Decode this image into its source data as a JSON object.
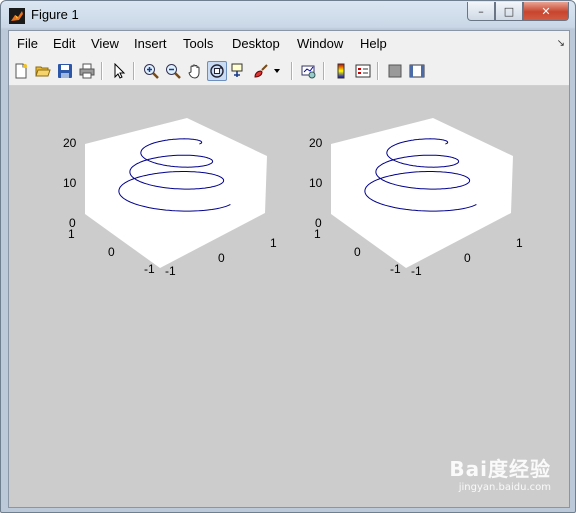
{
  "window": {
    "title": "Figure 1",
    "controls": {
      "minimize": "–",
      "maximize": "□",
      "close": "✕"
    }
  },
  "menubar": {
    "items": [
      "File",
      "Edit",
      "View",
      "Insert",
      "Tools",
      "Desktop",
      "Window",
      "Help"
    ],
    "dock_arrow": "↘"
  },
  "toolbar": {
    "tools": [
      "new-figure-icon",
      "open-file-icon",
      "save-icon",
      "print-icon",
      "edit-plot-arrow-icon",
      "zoom-in-icon",
      "zoom-out-icon",
      "pan-hand-icon",
      "rotate-3d-icon",
      "data-cursor-icon",
      "brush-icon",
      "brush-menu-arrow-icon",
      "link-plot-icon",
      "insert-colorbar-icon",
      "insert-legend-icon",
      "hide-plot-tools-icon",
      "show-plot-tools-icon"
    ],
    "active_tool": "rotate-3d-icon"
  },
  "chart_data": [
    {
      "type": "line",
      "view": "3d",
      "curve": "helix x=sin(t), y=cos(t), z=t, t in [0, 6π]",
      "color": "#00008b",
      "xlim": [
        -1,
        1
      ],
      "ylim": [
        -1,
        1
      ],
      "zlim": [
        0,
        20
      ],
      "xticks": [
        "-1",
        "0",
        "1"
      ],
      "yticks": [
        "-1",
        "0",
        "1"
      ],
      "zticks": [
        "0",
        "10",
        "20"
      ],
      "title": "",
      "xlabel": "",
      "ylabel": "",
      "zlabel": ""
    },
    {
      "type": "line",
      "view": "3d",
      "curve": "helix x=sin(t), y=cos(t), z=t, t in [0, 6π]",
      "color": "#00008b",
      "xlim": [
        -1,
        1
      ],
      "ylim": [
        -1,
        1
      ],
      "zlim": [
        0,
        20
      ],
      "xticks": [
        "-1",
        "0",
        "1"
      ],
      "yticks": [
        "-1",
        "0",
        "1"
      ],
      "zticks": [
        "0",
        "10",
        "20"
      ],
      "title": "",
      "xlabel": "",
      "ylabel": "",
      "zlabel": ""
    }
  ],
  "watermark": {
    "brand": "Bai度经验",
    "url": "jingyan.baidu.com"
  }
}
